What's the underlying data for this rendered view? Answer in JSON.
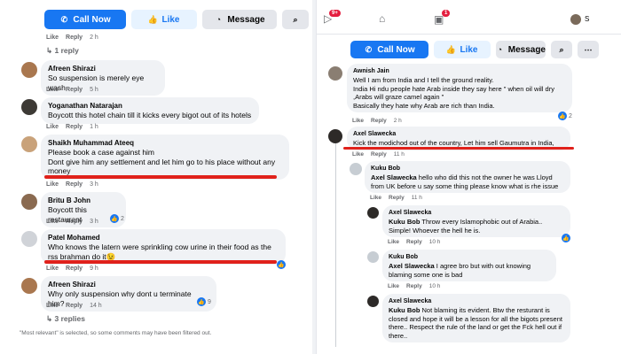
{
  "left": {
    "toolbar": {
      "call": "Call Now",
      "like": "Like",
      "message": "Message"
    },
    "top_meta": {
      "like": "Like",
      "reply": "Reply",
      "time": "2 h"
    },
    "reply_link_1": "1 reply",
    "comments": [
      {
        "author": "Afreen Shirazi",
        "text": "So suspension is merely eye wash",
        "like": "Like",
        "reply": "Reply",
        "time": "5 h"
      },
      {
        "author": "Yoganathan Natarajan",
        "text": "Boycott this hotel chain till it kicks every bigot out of its hotels",
        "like": "Like",
        "reply": "Reply",
        "time": "1 h"
      },
      {
        "author": "Shaikh Muhammad Ateeq",
        "text": "Please book a case against him\nDont give him any settlement and let him go to his place without any money",
        "like": "Like",
        "reply": "Reply",
        "time": "3 h"
      },
      {
        "author": "Britu B John",
        "text": "Boycott this restaurant",
        "like": "Like",
        "reply": "Reply",
        "time": "3 h",
        "reactions": "2"
      },
      {
        "author": "Patel Mohamed",
        "text": "Who knows the latern were sprinkling cow urine in their food as the rss brahman do it😉",
        "like": "Like",
        "reply": "Reply",
        "time": "9 h"
      },
      {
        "author": "Afreen Shirazi",
        "text": "Why only suspension why dont u terminate him?",
        "like": "Like",
        "reply": "Reply",
        "time": "14 h",
        "reactions": "9"
      }
    ],
    "reply_link_3": "3 replies",
    "footer": "\"Most relevant\" is selected, so some comments may have been filtered out."
  },
  "right": {
    "nav": {
      "badge_watch": "9+",
      "badge_groups": "1",
      "nav_letter": "S"
    },
    "toolbar": {
      "call": "Call Now",
      "like": "Like",
      "message": "Message"
    },
    "comments": [
      {
        "author": "Awnish Jain",
        "text": "Well I am from India and I tell the ground reality.\nIndia Hi ndu people hate Arab inside they say here \" when oil will dry ,Arabs will graze camel again \"\nBasically they hate why Arab are rich than India.",
        "like": "Like",
        "reply": "Reply",
        "time": "2 h",
        "reactions": "2"
      },
      {
        "author": "Axel Slawecka",
        "text": "Kick the modichod out of the country, Let him sell Gaumutra in India,",
        "like": "Like",
        "reply": "Reply",
        "time": "11 h"
      },
      {
        "author": "Kuku Bob",
        "mention": "Axel Slawecka",
        "text": " hello who did this not the owner he was Lloyd from UK before u say some thing please know what is rhe issue",
        "like": "Like",
        "reply": "Reply",
        "time": "11 h"
      },
      {
        "author": "Axel Slawecka",
        "mention": "Kuku Bob",
        "text": " Throw every Islamophobic out of Arabia.. Simple! Whoever the hell he is.",
        "like": "Like",
        "reply": "Reply",
        "time": "10 h"
      },
      {
        "author": "Kuku Bob",
        "mention": "Axel Slawecka",
        "text": " I agree bro but with out knowing blaming some one is bad",
        "like": "Like",
        "reply": "Reply",
        "time": "10 h"
      },
      {
        "author": "Axel Slawecka",
        "mention": "Kuku Bob",
        "text": " Not blaming its evident. Btw the resturant is closed and hope it will be a lesson for all the bigots present there.. Respect the rule of the land or get the Fck hell out if there.."
      }
    ]
  },
  "colors": {
    "primary": "#1877f2",
    "bubble": "#f0f2f5",
    "muted": "#65676b",
    "highlight": "#e0211b"
  }
}
